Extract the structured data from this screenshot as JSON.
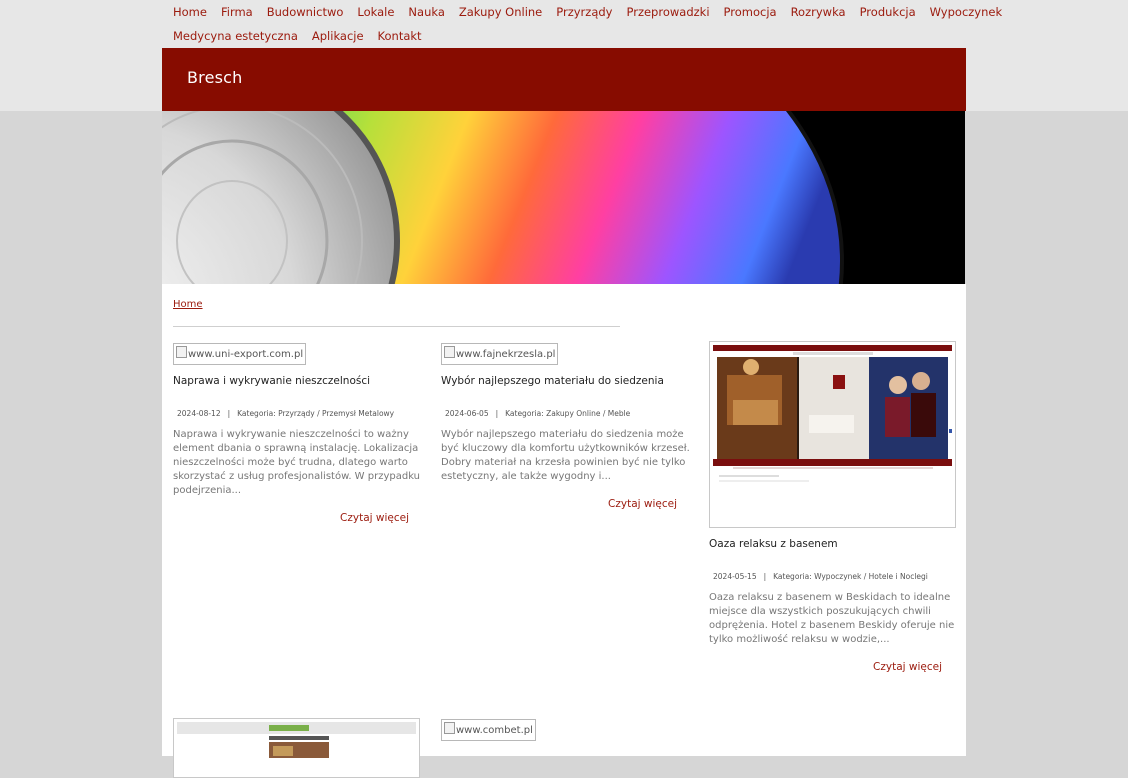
{
  "nav": {
    "row1": [
      "Home",
      "Firma",
      "Budownictwo",
      "Lokale",
      "Nauka",
      "Zakupy Online",
      "Przyrządy",
      "Przeprowadzki",
      "Promocja",
      "Rozrywka",
      "Produkcja",
      "Wypoczynek"
    ],
    "row2": [
      "Medycyna estetyczna",
      "Aplikacje",
      "Kontakt"
    ]
  },
  "header": {
    "site_title": "Bresch"
  },
  "breadcrumb": {
    "home": "Home"
  },
  "articles": [
    {
      "image_alt": "www.uni-export.com.pl",
      "title": "Naprawa i wykrywanie nieszczelności",
      "date": "2024-08-12",
      "category": "Kategoria: Przyrządy / Przemysł Metalowy",
      "excerpt": "Naprawa i wykrywanie nieszczelności to ważny element dbania o sprawną instalację. Lokalizacja nieszczelności może być trudna, dlatego warto skorzystać z usług profesjonalistów. W przypadku podejrzenia...",
      "more": "Czytaj więcej"
    },
    {
      "image_alt": "www.fajnekrzesla.pl",
      "title": "Wybór najlepszego materiału do siedzenia",
      "date": "2024-06-05",
      "category": "Kategoria: Zakupy Online / Meble",
      "excerpt": "Wybór najlepszego materiału do siedzenia może być kluczowy dla komfortu użytkowników krzeseł. Dobry materiał na krzesła powinien być nie tylko estetyczny, ale także wygodny i...",
      "more": "Czytaj więcej"
    },
    {
      "image_alt": "",
      "title": "Oaza relaksu z basenem",
      "date": "2024-05-15",
      "category": "Kategoria: Wypoczynek / Hotele i Noclegi",
      "excerpt": "Oaza relaksu z basenem w Beskidach to idealne miejsce dla wszystkich poszukujących chwili odprężenia. Hotel z basenem Beskidy oferuje nie tylko możliwość relaksu w wodzie,...",
      "more": "Czytaj więcej"
    },
    {
      "image_alt": "www.combet.pl"
    }
  ],
  "colors": {
    "accent": "#870c00",
    "link": "#9b1a0d",
    "page_bg": "#d6d6d6"
  }
}
